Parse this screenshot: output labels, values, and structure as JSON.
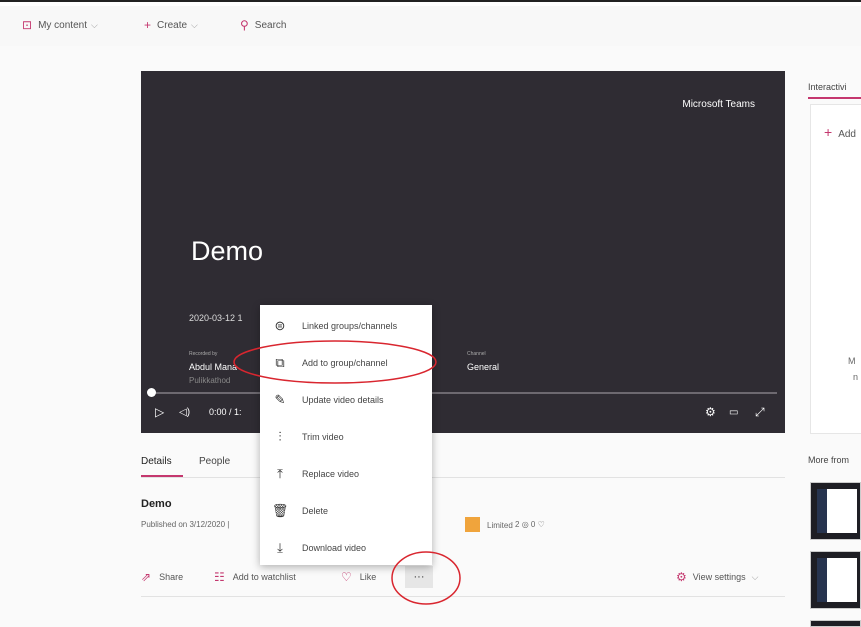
{
  "nav": {
    "my_content": "My content",
    "create": "Create",
    "search": "Search",
    "chevron": "⌵",
    "icons": [
      "video-icon",
      "plus-icon",
      "search-icon"
    ]
  },
  "player": {
    "brand": "Microsoft Teams",
    "title": "Demo",
    "date": "2020-03-12 1",
    "recorded_by_label": "Recorded by",
    "recorded_by": "Abdul Mana",
    "recorded_by_sub": "Pulikkathod",
    "channel_label": "Channel",
    "channel": "General",
    "time": "0:00 / 1:",
    "progress": 0
  },
  "side": {
    "title": "Interactivi",
    "add": "Add",
    "note1": "M",
    "note2": "n",
    "more_from": "More from"
  },
  "tabs": {
    "details": "Details",
    "people": "People"
  },
  "details": {
    "title": "Demo",
    "published": "Published on 3/12/2020 |",
    "orange_mark": "b",
    "limited": "Limited",
    "views": "2",
    "likes": "0"
  },
  "actions": {
    "share": "Share",
    "watchlist": "Add to watchlist",
    "like": "Like",
    "more": "···",
    "view_settings": "View settings"
  },
  "menu": {
    "items": [
      {
        "label": "Linked groups/channels",
        "icon": "linked-groups-icon"
      },
      {
        "label": "Add to group/channel",
        "icon": "add-to-group-icon"
      },
      {
        "label": "Update video details",
        "icon": "pencil-icon"
      },
      {
        "label": "Trim video",
        "icon": "trim-icon"
      },
      {
        "label": "Replace video",
        "icon": "upload-icon"
      },
      {
        "label": "Delete",
        "icon": "trash-icon"
      },
      {
        "label": "Download video",
        "icon": "download-icon"
      }
    ]
  },
  "colors": {
    "accent": "#c4376e",
    "player_bg": "#2f2c33",
    "annotation": "#d9262f",
    "limited": "#f0a43c"
  }
}
